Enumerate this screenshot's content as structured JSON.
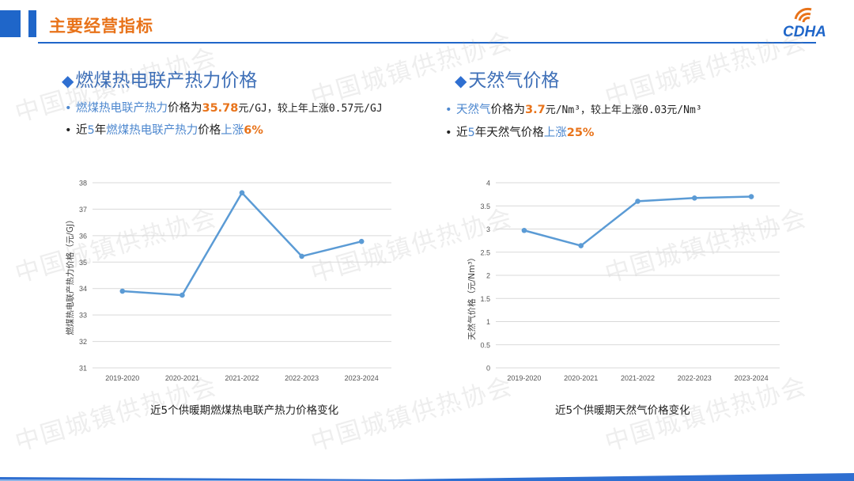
{
  "header": {
    "title": "主要经营指标",
    "logo_text": "CDHA"
  },
  "watermark": "中国城镇供热协会",
  "colors": {
    "accent_blue": "#1f66c9",
    "title_orange": "#e8731a",
    "line_blue": "#5b9bd5",
    "highlight_blue": "#4e88cf"
  },
  "left": {
    "section_title": "燃煤热电联产热力价格",
    "bullet1": {
      "part1": "燃煤热电联产热力",
      "part2": "价格为",
      "value": "35.78",
      "part3": "元/GJ，较上年上涨0.57元/GJ"
    },
    "bullet2": {
      "part1": "近",
      "years": "5",
      "part2": "年",
      "part3": "燃煤热电联产热力",
      "part4": "价格",
      "part5": "上涨",
      "value": "6%"
    },
    "caption": "近5个供暖期燃煤热电联产热力价格变化"
  },
  "right": {
    "section_title": "天然气价格",
    "bullet1": {
      "part1": "天然气",
      "part2": "价格为",
      "value": "3.7",
      "part3": "元/Nm³，较上年上涨0.03元/Nm³"
    },
    "bullet2": {
      "part1": "近",
      "years": "5",
      "part2": "年天然气价格",
      "part3": "上涨",
      "value": "25%"
    },
    "caption": "近5个供暖期天然气价格变化"
  },
  "chart_data": [
    {
      "type": "line",
      "categories": [
        "2019-2020",
        "2020-2021",
        "2021-2022",
        "2022-2023",
        "2023-2024"
      ],
      "values": [
        33.9,
        33.75,
        37.62,
        35.22,
        35.78
      ],
      "ylabel": "燃煤热电联产热力价格（元/GJ）",
      "ylim": [
        31,
        38
      ],
      "yticks": [
        31,
        32,
        33,
        34,
        35,
        36,
        37,
        38
      ],
      "grid": true,
      "legend": "none"
    },
    {
      "type": "line",
      "categories": [
        "2019-2020",
        "2020-2021",
        "2021-2022",
        "2022-2023",
        "2023-2024"
      ],
      "values": [
        2.97,
        2.64,
        3.6,
        3.67,
        3.7
      ],
      "ylabel": "天然气价格（元/Nm³）",
      "ylim": [
        0,
        4
      ],
      "yticks": [
        "0",
        "0.5",
        "1",
        "1.5",
        "2",
        "2.5",
        "3",
        "3.5",
        "4"
      ],
      "grid": true,
      "legend": "none"
    }
  ]
}
